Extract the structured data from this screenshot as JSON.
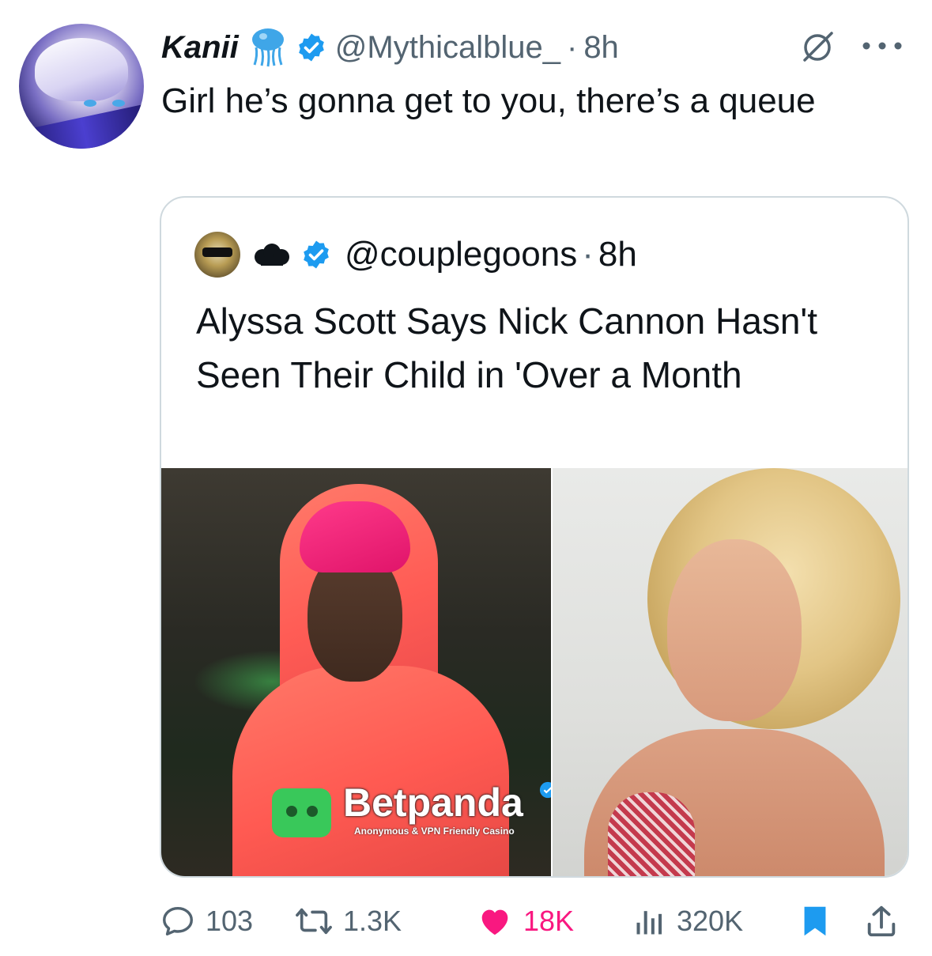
{
  "tweet": {
    "author": {
      "display_name": "Kanii",
      "handle": "@Mythicalblue_",
      "time": "8h",
      "separator": "·",
      "avatar_icon": "anime-avatar",
      "emoji_icon": "jellyfish-emoji",
      "verified_icon": "verified-badge"
    },
    "text": "Girl he’s gonna get to you, there’s a queue",
    "quoted": {
      "handle": "@couplegoons",
      "separator": "·",
      "time": "8h",
      "emoji_icon": "cloud-emoji",
      "title": "Alyssa Scott Says Nick Cannon Hasn't Seen Their Child in 'Over a Month",
      "image_watermark": {
        "brand": "Betpanda",
        "tagline": "Anonymous & VPN Friendly Casino"
      }
    },
    "actions": {
      "replies": "103",
      "retweets": "1.3K",
      "likes": "18K",
      "views": "320K"
    }
  },
  "colors": {
    "text": "#0f1419",
    "secondary": "#536471",
    "verified": "#1d9bf0",
    "like": "#f91880",
    "border": "#cfd9de"
  }
}
